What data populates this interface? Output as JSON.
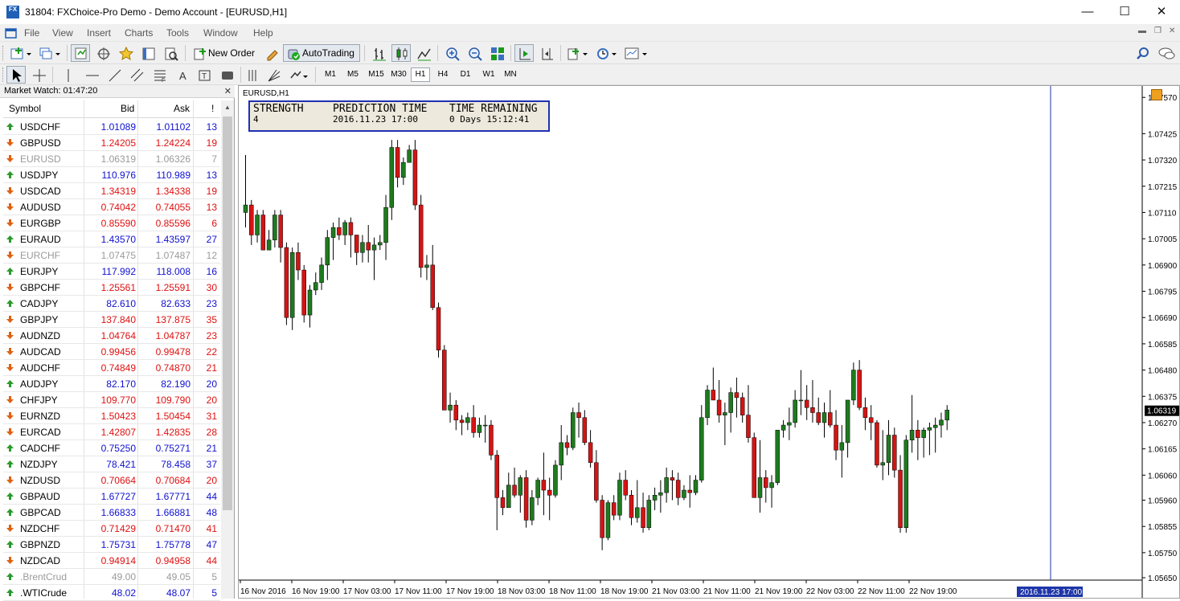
{
  "window": {
    "title": "31804: FXChoice-Pro Demo - Demo Account - [EURUSD,H1]",
    "app_icon_text": "FX"
  },
  "menu": [
    "File",
    "View",
    "Insert",
    "Charts",
    "Tools",
    "Window",
    "Help"
  ],
  "toolbar": {
    "new_order_label": "New Order",
    "autotrading_label": "AutoTrading",
    "timeframes": [
      "M1",
      "M5",
      "M15",
      "M30",
      "H1",
      "H4",
      "D1",
      "W1",
      "MN"
    ],
    "active_timeframe": "H1"
  },
  "market_watch": {
    "title": "Market Watch: 01:47:20",
    "columns": {
      "symbol": "Symbol",
      "bid": "Bid",
      "ask": "Ask",
      "spread": "!"
    },
    "rows": [
      {
        "symbol": "USDCHF",
        "bid": "1.01089",
        "ask": "1.01102",
        "spread": "13",
        "dir": "up"
      },
      {
        "symbol": "GBPUSD",
        "bid": "1.24205",
        "ask": "1.24224",
        "spread": "19",
        "dir": "down"
      },
      {
        "symbol": "EURUSD",
        "bid": "1.06319",
        "ask": "1.06326",
        "spread": "7",
        "dir": "down",
        "dim": true
      },
      {
        "symbol": "USDJPY",
        "bid": "110.976",
        "ask": "110.989",
        "spread": "13",
        "dir": "up"
      },
      {
        "symbol": "USDCAD",
        "bid": "1.34319",
        "ask": "1.34338",
        "spread": "19",
        "dir": "down"
      },
      {
        "symbol": "AUDUSD",
        "bid": "0.74042",
        "ask": "0.74055",
        "spread": "13",
        "dir": "down"
      },
      {
        "symbol": "EURGBP",
        "bid": "0.85590",
        "ask": "0.85596",
        "spread": "6",
        "dir": "down"
      },
      {
        "symbol": "EURAUD",
        "bid": "1.43570",
        "ask": "1.43597",
        "spread": "27",
        "dir": "up"
      },
      {
        "symbol": "EURCHF",
        "bid": "1.07475",
        "ask": "1.07487",
        "spread": "12",
        "dir": "down",
        "dim": true
      },
      {
        "symbol": "EURJPY",
        "bid": "117.992",
        "ask": "118.008",
        "spread": "16",
        "dir": "up"
      },
      {
        "symbol": "GBPCHF",
        "bid": "1.25561",
        "ask": "1.25591",
        "spread": "30",
        "dir": "down"
      },
      {
        "symbol": "CADJPY",
        "bid": "82.610",
        "ask": "82.633",
        "spread": "23",
        "dir": "up"
      },
      {
        "symbol": "GBPJPY",
        "bid": "137.840",
        "ask": "137.875",
        "spread": "35",
        "dir": "down"
      },
      {
        "symbol": "AUDNZD",
        "bid": "1.04764",
        "ask": "1.04787",
        "spread": "23",
        "dir": "down"
      },
      {
        "symbol": "AUDCAD",
        "bid": "0.99456",
        "ask": "0.99478",
        "spread": "22",
        "dir": "down"
      },
      {
        "symbol": "AUDCHF",
        "bid": "0.74849",
        "ask": "0.74870",
        "spread": "21",
        "dir": "down"
      },
      {
        "symbol": "AUDJPY",
        "bid": "82.170",
        "ask": "82.190",
        "spread": "20",
        "dir": "up"
      },
      {
        "symbol": "CHFJPY",
        "bid": "109.770",
        "ask": "109.790",
        "spread": "20",
        "dir": "down"
      },
      {
        "symbol": "EURNZD",
        "bid": "1.50423",
        "ask": "1.50454",
        "spread": "31",
        "dir": "down"
      },
      {
        "symbol": "EURCAD",
        "bid": "1.42807",
        "ask": "1.42835",
        "spread": "28",
        "dir": "down"
      },
      {
        "symbol": "CADCHF",
        "bid": "0.75250",
        "ask": "0.75271",
        "spread": "21",
        "dir": "up"
      },
      {
        "symbol": "NZDJPY",
        "bid": "78.421",
        "ask": "78.458",
        "spread": "37",
        "dir": "up"
      },
      {
        "symbol": "NZDUSD",
        "bid": "0.70664",
        "ask": "0.70684",
        "spread": "20",
        "dir": "down"
      },
      {
        "symbol": "GBPAUD",
        "bid": "1.67727",
        "ask": "1.67771",
        "spread": "44",
        "dir": "up"
      },
      {
        "symbol": "GBPCAD",
        "bid": "1.66833",
        "ask": "1.66881",
        "spread": "48",
        "dir": "up"
      },
      {
        "symbol": "NZDCHF",
        "bid": "0.71429",
        "ask": "0.71470",
        "spread": "41",
        "dir": "down"
      },
      {
        "symbol": "GBPNZD",
        "bid": "1.75731",
        "ask": "1.75778",
        "spread": "47",
        "dir": "up"
      },
      {
        "symbol": "NZDCAD",
        "bid": "0.94914",
        "ask": "0.94958",
        "spread": "44",
        "dir": "down"
      },
      {
        "symbol": ".BrentCrud",
        "bid": "49.00",
        "ask": "49.05",
        "spread": "5",
        "dir": "up",
        "dim": true
      },
      {
        "symbol": ".WTICrude",
        "bid": "48.02",
        "ask": "48.07",
        "spread": "5",
        "dir": "up"
      }
    ]
  },
  "chart": {
    "label": "EURUSD,H1",
    "info": {
      "strength_label": "STRENGTH",
      "strength_value": "4",
      "prediction_label": "PREDICTION TIME",
      "prediction_value": "2016.11.23 17:00",
      "remaining_label": "TIME REMAINING",
      "remaining_value": "0 Days 15:12:41"
    },
    "future_time_label": "2016.11.23 17:00"
  },
  "chart_data": {
    "type": "candlestick",
    "symbol": "EURUSD",
    "timeframe": "H1",
    "price_ticks": [
      "1.07570",
      "1.07425",
      "1.07320",
      "1.07215",
      "1.07110",
      "1.07005",
      "1.06900",
      "1.06795",
      "1.06690",
      "1.06585",
      "1.06480",
      "1.06375",
      "1.06270",
      "1.06165",
      "1.06060",
      "1.05960",
      "1.05855",
      "1.05750",
      "1.05650"
    ],
    "time_ticks": [
      "16 Nov 2016",
      "16 Nov 19:00",
      "17 Nov 03:00",
      "17 Nov 11:00",
      "17 Nov 19:00",
      "18 Nov 03:00",
      "18 Nov 11:00",
      "18 Nov 19:00",
      "21 Nov 03:00",
      "21 Nov 11:00",
      "21 Nov 19:00",
      "22 Nov 03:00",
      "22 Nov 11:00",
      "22 Nov 19:00"
    ],
    "current_price": "1.06319",
    "ylim": [
      1.0565,
      1.0759
    ],
    "colors": {
      "bull": "#1f7a1f",
      "bear": "#d41414",
      "current": "#000000",
      "future_box": "#1e36a8"
    },
    "candles": [
      [
        1.0711,
        1.0734,
        1.0705,
        1.0714
      ],
      [
        1.0714,
        1.0716,
        1.0698,
        1.0702
      ],
      [
        1.0702,
        1.0712,
        1.0699,
        1.071
      ],
      [
        1.071,
        1.0712,
        1.0696,
        1.0696
      ],
      [
        1.0696,
        1.0704,
        1.0696,
        1.07
      ],
      [
        1.07,
        1.0712,
        1.0697,
        1.071
      ],
      [
        1.071,
        1.0712,
        1.0691,
        1.0697
      ],
      [
        1.0697,
        1.0699,
        1.0666,
        1.0669
      ],
      [
        1.0669,
        1.0697,
        1.0664,
        1.0695
      ],
      [
        1.0695,
        1.0699,
        1.0684,
        1.0688
      ],
      [
        1.0688,
        1.069,
        1.0667,
        1.067
      ],
      [
        1.067,
        1.0682,
        1.0665,
        1.068
      ],
      [
        1.068,
        1.0687,
        1.0678,
        1.0683
      ],
      [
        1.0683,
        1.0693,
        1.068,
        1.069
      ],
      [
        1.069,
        1.0704,
        1.0684,
        1.0701
      ],
      [
        1.0701,
        1.0707,
        1.0692,
        1.0705
      ],
      [
        1.0705,
        1.0709,
        1.07,
        1.0702
      ],
      [
        1.0702,
        1.0708,
        1.0698,
        1.0707
      ],
      [
        1.0707,
        1.0709,
        1.0693,
        1.0702
      ],
      [
        1.0702,
        1.0702,
        1.069,
        1.0695
      ],
      [
        1.0695,
        1.0702,
        1.0691,
        1.0699
      ],
      [
        1.0699,
        1.0706,
        1.0691,
        1.0696
      ],
      [
        1.0696,
        1.0701,
        1.0684,
        1.0698
      ],
      [
        1.0698,
        1.0702,
        1.0696,
        1.0699
      ],
      [
        1.0699,
        1.0718,
        1.0692,
        1.0713
      ],
      [
        1.0713,
        1.074,
        1.0708,
        1.0737
      ],
      [
        1.0737,
        1.074,
        1.0721,
        1.0725
      ],
      [
        1.0725,
        1.0733,
        1.0722,
        1.0731
      ],
      [
        1.0731,
        1.0738,
        1.0732,
        1.0736
      ],
      [
        1.0736,
        1.074,
        1.0712,
        1.0714
      ],
      [
        1.0714,
        1.0718,
        1.0685,
        1.0689
      ],
      [
        1.0689,
        1.0694,
        1.0684,
        1.069
      ],
      [
        1.069,
        1.0698,
        1.0672,
        1.0673
      ],
      [
        1.0673,
        1.0675,
        1.0653,
        1.0656
      ],
      [
        1.0656,
        1.0658,
        1.0635,
        1.0632
      ],
      [
        1.0632,
        1.0639,
        1.0627,
        1.0634
      ],
      [
        1.0634,
        1.0636,
        1.0624,
        1.0628
      ],
      [
        1.0628,
        1.063,
        1.0622,
        1.0627
      ],
      [
        1.0627,
        1.0631,
        1.0624,
        1.0629
      ],
      [
        1.0629,
        1.0634,
        1.0621,
        1.0623
      ],
      [
        1.0623,
        1.0629,
        1.0621,
        1.0626
      ],
      [
        1.0626,
        1.063,
        1.0619,
        1.0626
      ],
      [
        1.0626,
        1.0628,
        1.0612,
        1.0614
      ],
      [
        1.0614,
        1.0616,
        1.0584,
        1.0597
      ],
      [
        1.0597,
        1.06,
        1.059,
        1.0593
      ],
      [
        1.0593,
        1.0607,
        1.0599,
        1.0602
      ],
      [
        1.0602,
        1.0609,
        1.0597,
        1.0598
      ],
      [
        1.0598,
        1.0606,
        1.0591,
        1.0605
      ],
      [
        1.0605,
        1.0608,
        1.0585,
        1.0588
      ],
      [
        1.0588,
        1.06,
        1.0586,
        1.0597
      ],
      [
        1.0597,
        1.0605,
        1.0594,
        1.0604
      ],
      [
        1.0604,
        1.0615,
        1.059,
        1.06
      ],
      [
        1.06,
        1.0605,
        1.0588,
        1.0598
      ],
      [
        1.0598,
        1.0612,
        1.0597,
        1.061
      ],
      [
        1.061,
        1.0626,
        1.0604,
        1.0619
      ],
      [
        1.0619,
        1.0622,
        1.0614,
        1.0617
      ],
      [
        1.0617,
        1.0633,
        1.0616,
        1.0631
      ],
      [
        1.0631,
        1.0635,
        1.0621,
        1.0629
      ],
      [
        1.0629,
        1.0632,
        1.0618,
        1.0619
      ],
      [
        1.0619,
        1.0624,
        1.0609,
        1.0611
      ],
      [
        1.0611,
        1.0616,
        1.0595,
        1.0596
      ],
      [
        1.0596,
        1.0598,
        1.0576,
        1.0581
      ],
      [
        1.0581,
        1.0596,
        1.058,
        1.0595
      ],
      [
        1.0595,
        1.0598,
        1.0588,
        1.059
      ],
      [
        1.059,
        1.0607,
        1.0588,
        1.0604
      ],
      [
        1.0604,
        1.0608,
        1.0596,
        1.0598
      ],
      [
        1.0598,
        1.06,
        1.0586,
        1.0589
      ],
      [
        1.0589,
        1.0604,
        1.0587,
        1.0593
      ],
      [
        1.0593,
        1.0599,
        1.0583,
        1.0585
      ],
      [
        1.0585,
        1.0598,
        1.0584,
        1.0596
      ],
      [
        1.0596,
        1.0601,
        1.0592,
        1.0598
      ],
      [
        1.0598,
        1.0604,
        1.0591,
        1.0599
      ],
      [
        1.0599,
        1.0609,
        1.0595,
        1.0605
      ],
      [
        1.0605,
        1.0608,
        1.0596,
        1.0604
      ],
      [
        1.0604,
        1.0607,
        1.0594,
        1.0597
      ],
      [
        1.0597,
        1.0602,
        1.0596,
        1.06
      ],
      [
        1.06,
        1.0606,
        1.0593,
        1.0599
      ],
      [
        1.0599,
        1.0606,
        1.0598,
        1.0604
      ],
      [
        1.0604,
        1.0634,
        1.0603,
        1.0629
      ],
      [
        1.0629,
        1.0642,
        1.0626,
        1.064
      ],
      [
        1.064,
        1.0649,
        1.0636,
        1.0636
      ],
      [
        1.0636,
        1.0644,
        1.0627,
        1.063
      ],
      [
        1.063,
        1.0635,
        1.0618,
        1.0631
      ],
      [
        1.0631,
        1.0641,
        1.0623,
        1.0639
      ],
      [
        1.0639,
        1.0645,
        1.0629,
        1.0637
      ],
      [
        1.0637,
        1.0639,
        1.0627,
        1.063
      ],
      [
        1.063,
        1.0642,
        1.0619,
        1.0621
      ],
      [
        1.0621,
        1.0623,
        1.0608,
        1.0597
      ],
      [
        1.0597,
        1.062,
        1.0591,
        1.0605
      ],
      [
        1.0605,
        1.0608,
        1.0595,
        1.0601
      ],
      [
        1.0601,
        1.0606,
        1.0593,
        1.0603
      ],
      [
        1.0603,
        1.061,
        1.0602,
        1.0624
      ],
      [
        1.0624,
        1.0628,
        1.0621,
        1.0626
      ],
      [
        1.0626,
        1.0633,
        1.062,
        1.0627
      ],
      [
        1.0627,
        1.064,
        1.0625,
        1.0636
      ],
      [
        1.0636,
        1.0648,
        1.063,
        1.0636
      ],
      [
        1.0636,
        1.0642,
        1.0628,
        1.0633
      ],
      [
        1.0633,
        1.0644,
        1.0627,
        1.0631
      ],
      [
        1.0631,
        1.0637,
        1.0626,
        1.0627
      ],
      [
        1.0627,
        1.0635,
        1.0621,
        1.0631
      ],
      [
        1.0631,
        1.064,
        1.0625,
        1.0626
      ],
      [
        1.0626,
        1.0632,
        1.0612,
        1.0616
      ],
      [
        1.0616,
        1.0626,
        1.0605,
        1.0619
      ],
      [
        1.0619,
        1.0635,
        1.0613,
        1.0636
      ],
      [
        1.0636,
        1.0651,
        1.0634,
        1.0648
      ],
      [
        1.0648,
        1.0652,
        1.0632,
        1.0633
      ],
      [
        1.0633,
        1.0637,
        1.0624,
        1.0629
      ],
      [
        1.0629,
        1.0634,
        1.062,
        1.0627
      ],
      [
        1.0627,
        1.0628,
        1.0609,
        1.061
      ],
      [
        1.061,
        1.0624,
        1.0604,
        1.0611
      ],
      [
        1.0611,
        1.0628,
        1.0606,
        1.0622
      ],
      [
        1.0622,
        1.0625,
        1.0605,
        1.0608
      ],
      [
        1.0608,
        1.0614,
        1.0583,
        1.0585
      ],
      [
        1.0585,
        1.0622,
        1.0583,
        1.062
      ],
      [
        1.062,
        1.0638,
        1.0615,
        1.0624
      ],
      [
        1.0624,
        1.0628,
        1.0612,
        1.0621
      ],
      [
        1.0621,
        1.0625,
        1.0613,
        1.0624
      ],
      [
        1.0624,
        1.0627,
        1.0614,
        1.0625
      ],
      [
        1.0625,
        1.0629,
        1.0615,
        1.0626
      ],
      [
        1.0626,
        1.0631,
        1.0621,
        1.0628
      ],
      [
        1.0628,
        1.0634,
        1.0624,
        1.0632
      ]
    ]
  }
}
